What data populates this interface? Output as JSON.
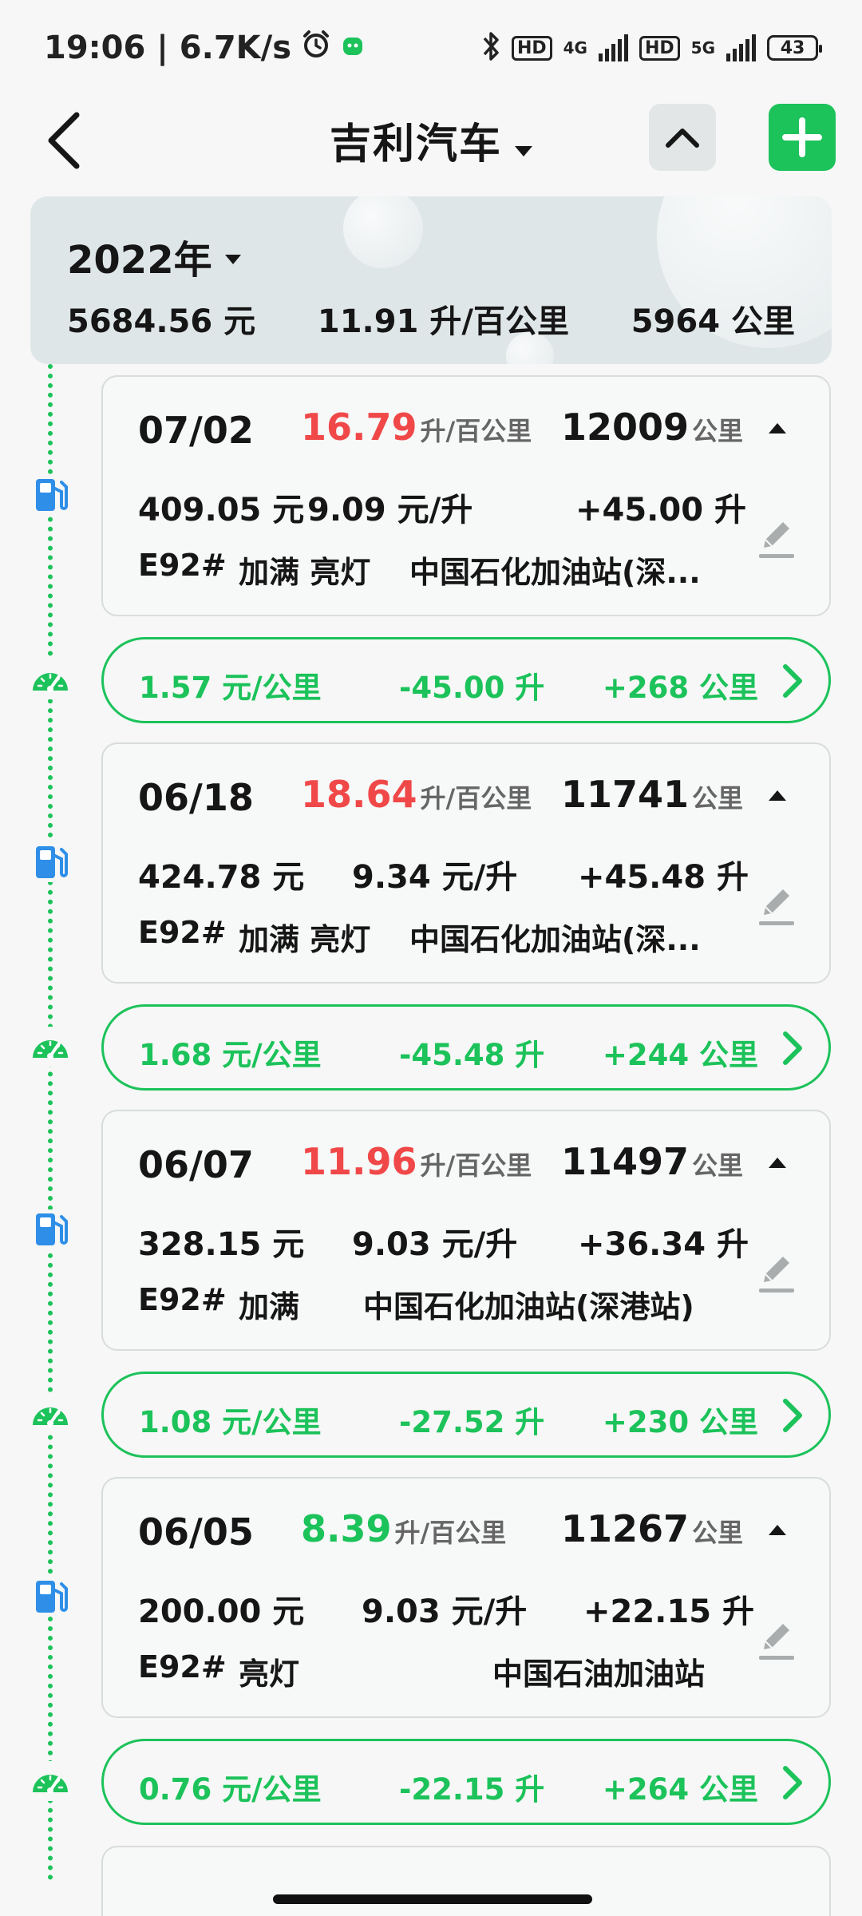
{
  "status_bar": {
    "time_speed": "19:06 | 6.7K/s",
    "hd1": "HD",
    "net1": "4G",
    "hd2": "HD",
    "net2": "5G",
    "battery": "43"
  },
  "header": {
    "title": "吉利汽车"
  },
  "summary": {
    "year": "2022年",
    "total_cost": "5684.56 元",
    "avg_consumption": "11.91 升/百公里",
    "total_distance": "5964 公里"
  },
  "colors": {
    "accent": "#1cc25a",
    "warning_red": "#f04848",
    "timeline_icon_blue": "#2f8fe8"
  },
  "records": [
    {
      "date": "07/02",
      "consumption": "16.79",
      "consumption_color": "#f04848",
      "consumption_unit": "升/百公里",
      "odometer": "12009",
      "odometer_unit": "公里",
      "cost": "409.05 元",
      "price": "9.09 元/升",
      "volume": "+45.00 升",
      "fuel": "E92#",
      "tags": "加满 亮灯",
      "station": "中国石化加油站(深..."
    },
    {
      "date": "06/18",
      "consumption": "18.64",
      "consumption_color": "#f04848",
      "consumption_unit": "升/百公里",
      "odometer": "11741",
      "odometer_unit": "公里",
      "cost": "424.78 元",
      "price": "9.34 元/升",
      "volume": "+45.48 升",
      "fuel": "E92#",
      "tags": "加满 亮灯",
      "station": "中国石化加油站(深..."
    },
    {
      "date": "06/07",
      "consumption": "11.96",
      "consumption_color": "#f04848",
      "consumption_unit": "升/百公里",
      "odometer": "11497",
      "odometer_unit": "公里",
      "cost": "328.15 元",
      "price": "9.03 元/升",
      "volume": "+36.34 升",
      "fuel": "E92#",
      "tags": "加满",
      "station": "中国石化加油站(深港站)"
    },
    {
      "date": "06/05",
      "consumption": "8.39",
      "consumption_color": "#1cc25a",
      "consumption_unit": "升/百公里",
      "odometer": "11267",
      "odometer_unit": "公里",
      "cost": "200.00 元",
      "price": "9.03 元/升",
      "volume": "+22.15 升",
      "fuel": "E92#",
      "tags": "亮灯",
      "station": "中国石油加油站"
    }
  ],
  "segments": [
    {
      "cost_per_km": "1.57 元/公里",
      "fuel_used": "-45.00 升",
      "distance": "+268 公里"
    },
    {
      "cost_per_km": "1.68 元/公里",
      "fuel_used": "-45.48 升",
      "distance": "+244 公里"
    },
    {
      "cost_per_km": "1.08 元/公里",
      "fuel_used": "-27.52 升",
      "distance": "+230 公里"
    },
    {
      "cost_per_km": "0.76 元/公里",
      "fuel_used": "-22.15 升",
      "distance": "+264 公里"
    }
  ]
}
